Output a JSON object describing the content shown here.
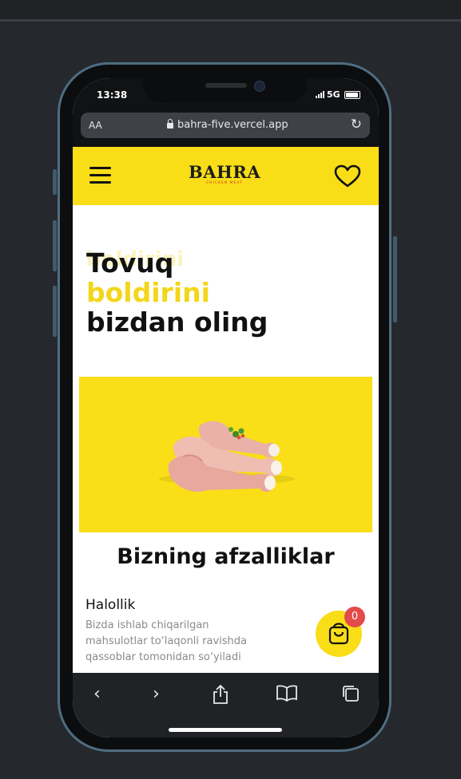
{
  "status": {
    "time": "13:38",
    "network": "5G"
  },
  "browser": {
    "aa_label": "AA",
    "url": "bahra-five.vercel.app"
  },
  "site": {
    "logo_text": "BAHRA",
    "logo_tagline": "CHICKEN MEAT",
    "hero": {
      "ghost_text": "boldirini",
      "line1": "Tovuq",
      "line2": "boldirini",
      "line3": "bizdan oling"
    },
    "section_title": "Bizning afzalliklar",
    "feature": {
      "title": "Halollik",
      "description": "Bizda ishlab chiqarilgan mahsulotlar to‘laqonli ravishda qassoblar tomonidan so‘yiladi"
    },
    "cart_count": "0"
  },
  "colors": {
    "brand_yellow": "#f9dd17",
    "badge_red": "#e34a4a"
  },
  "icons": [
    "menu-icon",
    "heart-icon",
    "shopping-bag-icon",
    "back-icon",
    "forward-icon",
    "share-icon",
    "bookmarks-icon",
    "tabs-icon",
    "reload-icon",
    "lock-icon"
  ]
}
